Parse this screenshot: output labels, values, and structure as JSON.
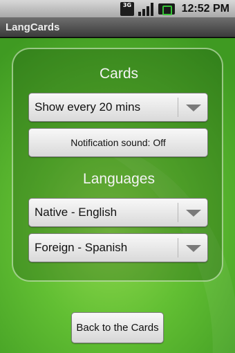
{
  "status_bar": {
    "network_label": "3G",
    "time": "12:52 PM",
    "icons": [
      "3g-icon",
      "signal-icon",
      "battery-charging-icon"
    ],
    "battery_color": "#37c437"
  },
  "title_bar": {
    "title": "LangCards"
  },
  "cards_section": {
    "heading": "Cards",
    "interval_spinner": {
      "selected": "Show every 20 mins"
    },
    "notification_button": {
      "label": "Notification sound: Off"
    }
  },
  "languages_section": {
    "heading": "Languages",
    "native_spinner": {
      "selected": "Native - English"
    },
    "foreign_spinner": {
      "selected": "Foreign - Spanish"
    }
  },
  "back_button": {
    "label": "Back to the Cards"
  },
  "colors": {
    "background_green": "#62bf33",
    "title_bar": "#4a4a4a",
    "status_bar": "#bfbfbf"
  }
}
